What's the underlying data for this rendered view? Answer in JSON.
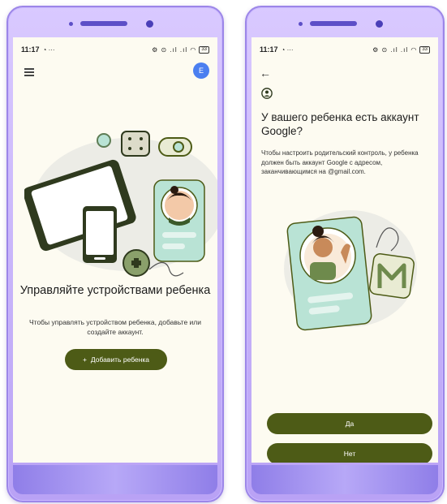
{
  "screen_left": {
    "status": {
      "time": "11:17",
      "indicators": "⚙ ⊙ .ıl .ıl ◠",
      "battery": "33"
    },
    "avatar_letter": "E",
    "title": "Управляйте устройствами ребенка",
    "description": "Чтобы управлять устройством ребенка, добавьте или создайте аккаунт.",
    "add_child_button": {
      "icon": "+",
      "label": "Добавить ребенка"
    }
  },
  "screen_right": {
    "status": {
      "time": "11:17",
      "indicators": "⚙ ⊙ .ıl .ıl ◠",
      "battery": "33"
    },
    "title": "У вашего ребенка есть аккаунт Google?",
    "description": "Чтобы настроить родительский контроль, у ребенка должен быть аккаунт Google с адресом, заканчивающимся на @gmail.com.",
    "yes_button": "Да",
    "no_button": "Нет"
  },
  "colors": {
    "primary_button": "#4d5b16",
    "screen_background": "#fdfbf1",
    "frame": "#b9a2f5",
    "avatar": "#4b7ff0",
    "illustration_mint": "#b9e3d5"
  },
  "icons": {
    "menu": "menu-icon",
    "avatar": "avatar",
    "back": "back-arrow-icon",
    "account": "account-circle-icon",
    "add": "plus-icon"
  }
}
